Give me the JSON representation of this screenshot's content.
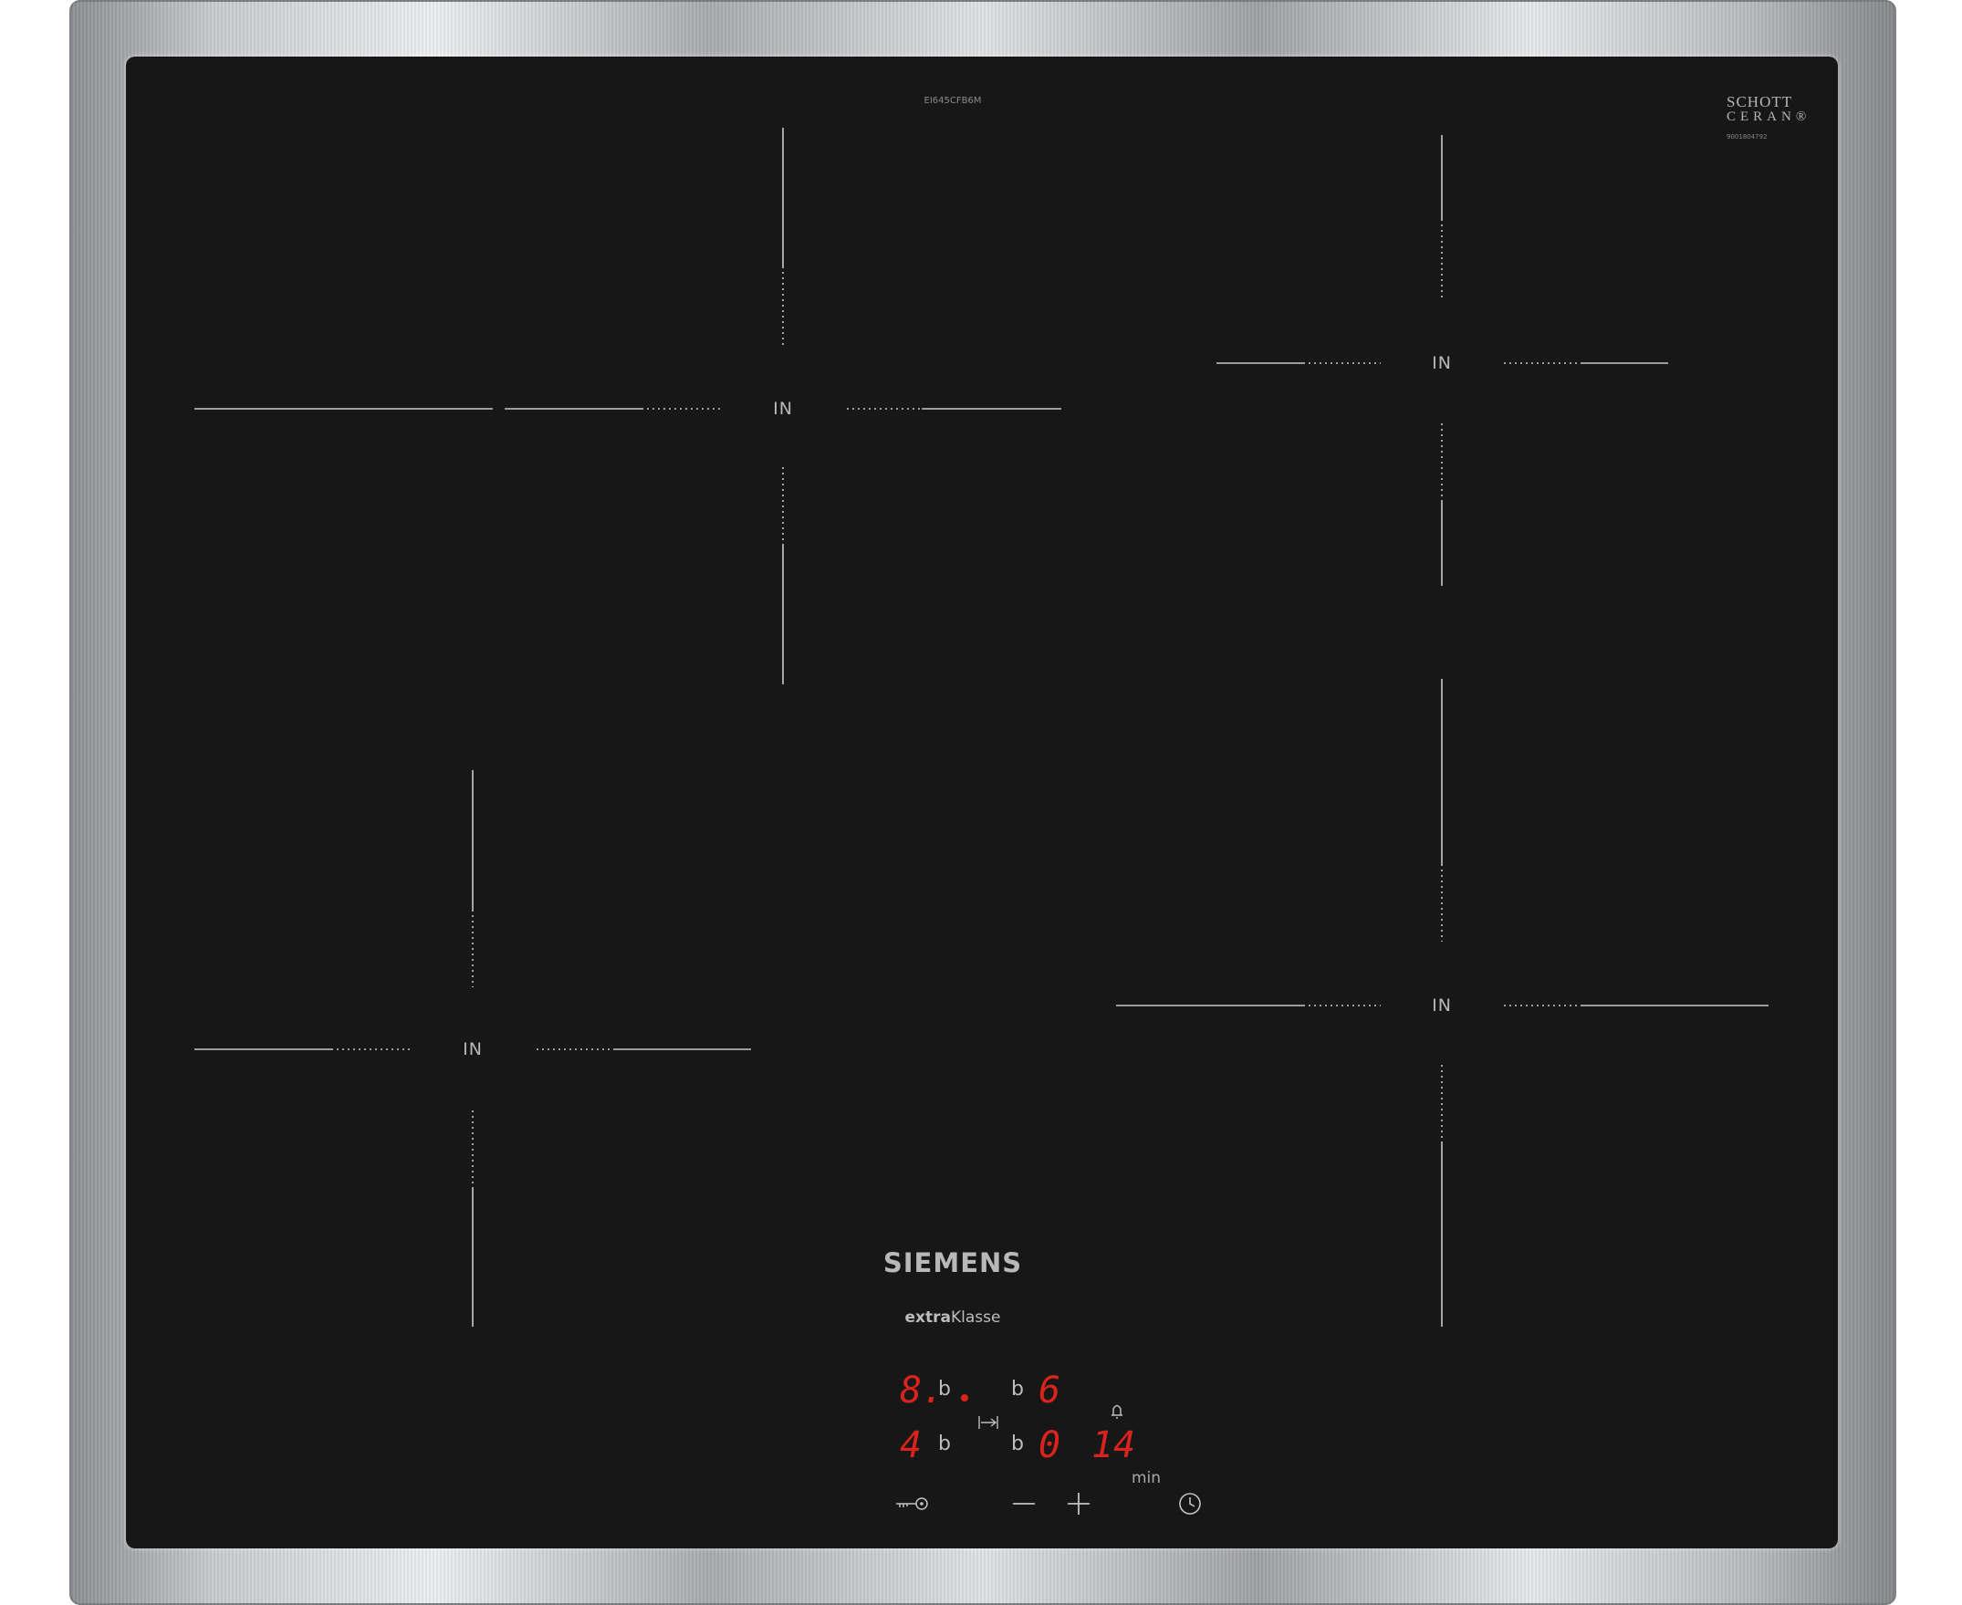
{
  "model_label": "EI645CFB6M",
  "glass_brand": {
    "line1": "SCHOTT",
    "line2": "CERAN®",
    "code": "9001804792"
  },
  "zones": {
    "front_left": {
      "label": "IN"
    },
    "rear_left": {
      "label": "IN"
    },
    "rear_right": {
      "label": "IN"
    },
    "front_right": {
      "label": "IN"
    }
  },
  "brand": {
    "name": "SIEMENS",
    "sub_bold": "extra",
    "sub_rest": "Klasse"
  },
  "display": {
    "top_left_level": "8.",
    "top_left_b": "b",
    "top_right_b": "b",
    "top_right_level": "6",
    "bottom_left_level": "4",
    "bottom_left_b": "b",
    "bottom_right_b": "b",
    "bottom_right_level": "0",
    "timer_value": "14",
    "timer_unit": "min"
  },
  "colors": {
    "glass": "#171717",
    "display_red": "#d9231c",
    "print": "#bdbdbd"
  }
}
